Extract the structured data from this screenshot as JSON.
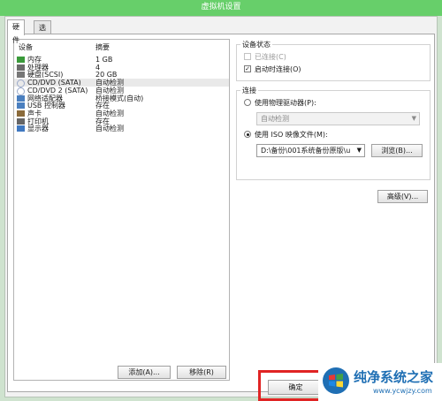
{
  "window": {
    "title": "虚拟机设置"
  },
  "tabs": [
    {
      "label": "硬件"
    },
    {
      "label": "选项"
    }
  ],
  "device_list": {
    "headers": {
      "device": "设备",
      "summary": "摘要"
    },
    "rows": [
      {
        "name": "内存",
        "summary": "1 GB",
        "icon": "memory-icon"
      },
      {
        "name": "处理器",
        "summary": "4",
        "icon": "cpu-icon"
      },
      {
        "name": "硬盘(SCSI)",
        "summary": "20 GB",
        "icon": "hard-disk-icon"
      },
      {
        "name": "CD/DVD (SATA)",
        "summary": "自动检测",
        "icon": "cd-dvd-icon"
      },
      {
        "name": "CD/DVD 2 (SATA)",
        "summary": "自动检测",
        "icon": "cd-dvd-icon"
      },
      {
        "name": "网络适配器",
        "summary": "桥接模式(自动)",
        "icon": "network-adapter-icon"
      },
      {
        "name": "USB 控制器",
        "summary": "存在",
        "icon": "usb-icon"
      },
      {
        "name": "声卡",
        "summary": "自动检测",
        "icon": "sound-card-icon"
      },
      {
        "name": "打印机",
        "summary": "存在",
        "icon": "printer-icon"
      },
      {
        "name": "显示器",
        "summary": "自动检测",
        "icon": "display-icon"
      }
    ],
    "selected_index": 3
  },
  "buttons": {
    "add": "添加(A)...",
    "remove": "移除(R)",
    "ok": "确定",
    "browse": "浏览(B)...",
    "advanced": "高级(V)..."
  },
  "device_status": {
    "title": "设备状态",
    "connected": {
      "label": "已连接(C)",
      "checked": false,
      "enabled": false
    },
    "connect_at_power_on": {
      "label": "启动时连接(O)",
      "checked": true
    }
  },
  "connection": {
    "title": "连接",
    "physical_drive": {
      "label": "使用物理驱动器(P):",
      "selected": false,
      "combo_value": "自动检测"
    },
    "iso_image": {
      "label": "使用 ISO 映像文件(M):",
      "selected": true,
      "path": "D:\\备份\\001系统备份原版\\u"
    }
  },
  "watermark": {
    "name": "纯净系统之家",
    "url": "www.ycwjzy.com"
  },
  "colors": {
    "title_bar": "#67cf6a",
    "highlight": "#e02424",
    "watermark_blue": "#1f6fb4"
  }
}
